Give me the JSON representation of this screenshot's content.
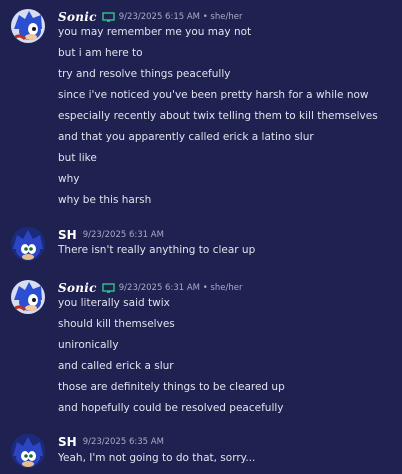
{
  "messages": [
    {
      "author": "Sonic",
      "styled": true,
      "badge": "monitor-icon",
      "timestamp": "9/23/2025 6:15 AM",
      "pronouns": "• she/her",
      "lines": [
        "you may remember me you may not",
        "but i am here to",
        "try and resolve things peacefully",
        "since i've noticed you've been pretty harsh for a while now",
        "especially recently about twix telling them to kill themselves",
        "and that you apparently called erick a latino slur",
        "but like",
        "why",
        "why be this harsh"
      ]
    },
    {
      "author": "SH",
      "styled": false,
      "timestamp": "9/23/2025 6:31 AM",
      "lines": [
        "There isn't really anything to clear up"
      ]
    },
    {
      "author": "Sonic",
      "styled": true,
      "badge": "monitor-icon",
      "timestamp": "9/23/2025 6:31 AM",
      "pronouns": "• she/her",
      "lines": [
        "you literally said twix",
        "should kill themselves",
        "unironically",
        "and called erick a slur",
        "those are definitely things to be cleared up",
        "and hopefully could be resolved peacefully"
      ]
    },
    {
      "author": "SH",
      "styled": false,
      "timestamp": "9/23/2025 6:35 AM",
      "lines": [
        "Yeah, I'm not going to do that, sorry..."
      ]
    }
  ],
  "colors": {
    "background": "#1f2150",
    "badge": "#2fc58a"
  }
}
